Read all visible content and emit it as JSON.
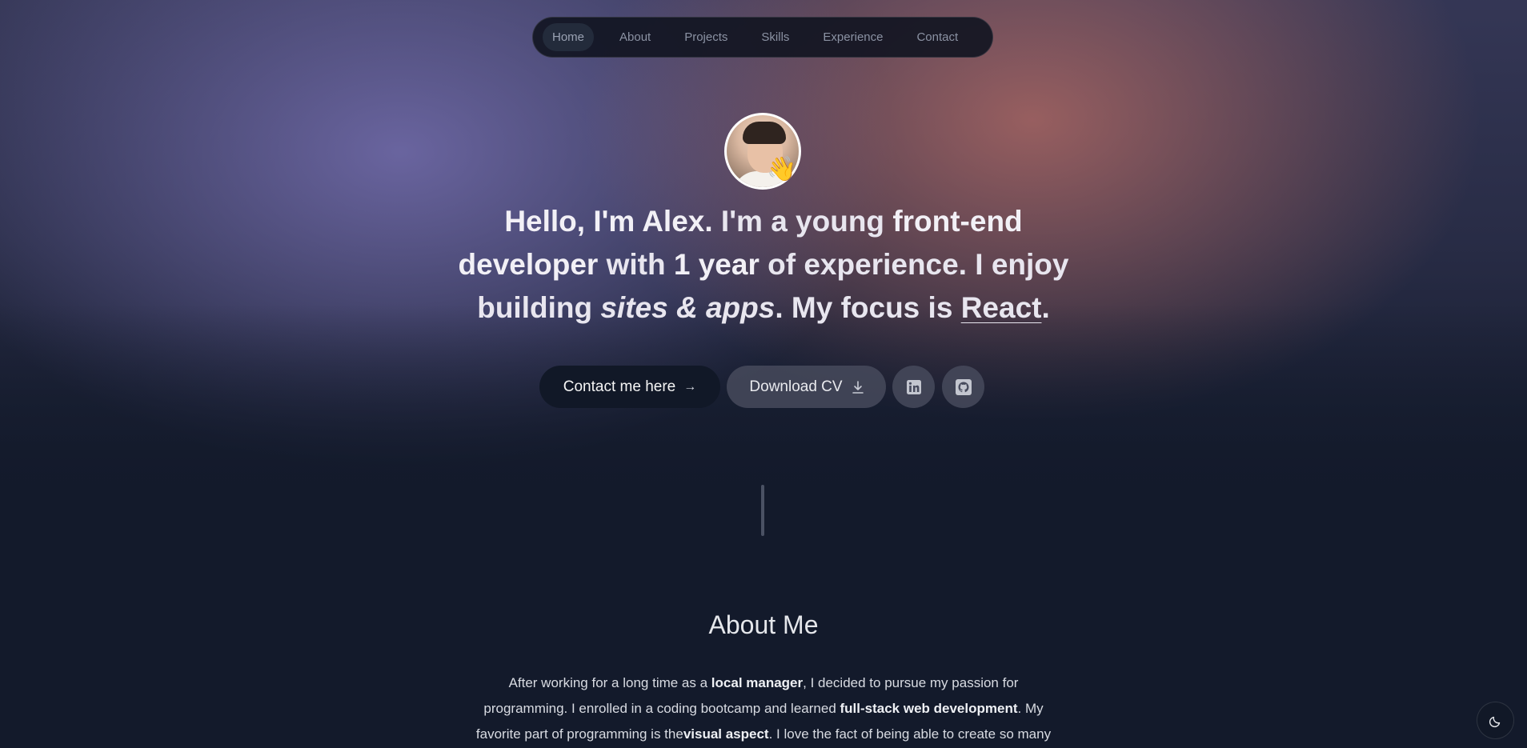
{
  "nav": {
    "items": [
      {
        "label": "Home",
        "active": true
      },
      {
        "label": "About"
      },
      {
        "label": "Projects"
      },
      {
        "label": "Skills"
      },
      {
        "label": "Experience"
      },
      {
        "label": "Contact"
      }
    ]
  },
  "hero": {
    "wave_emoji": "👋",
    "greeting": "Hello, I'm Alex.",
    "t1": " I'm a young ",
    "role": "front-end developer",
    "t2": " with ",
    "years": "1 year",
    "t3": " of experience. I enjoy building ",
    "focus_italic": "sites & apps",
    "t4": ". My focus is ",
    "tech": "React",
    "t5": ".",
    "contact_label": "Contact me here",
    "contact_arrow": "→",
    "download_label": "Download CV",
    "linkedin_icon": "linkedin-icon",
    "github_icon": "github-icon"
  },
  "about": {
    "title": "About Me",
    "p1": "After working for a long time as a ",
    "b1": "local manager",
    "p2": ", I decided to pursue my passion for programming. I enrolled in a coding bootcamp and learned ",
    "b2": "full-stack web development",
    "p3": ". My favorite part of programming is the",
    "b3": "visual aspect",
    "p4": ". I love the fact of being able to create so many"
  },
  "theme_toggle": {
    "icon": "moon-icon"
  },
  "colors": {
    "background": "#131a2b",
    "button_dark": "#111827",
    "gradient_violet": "#706aa8",
    "gradient_rose": "#b26a64"
  }
}
